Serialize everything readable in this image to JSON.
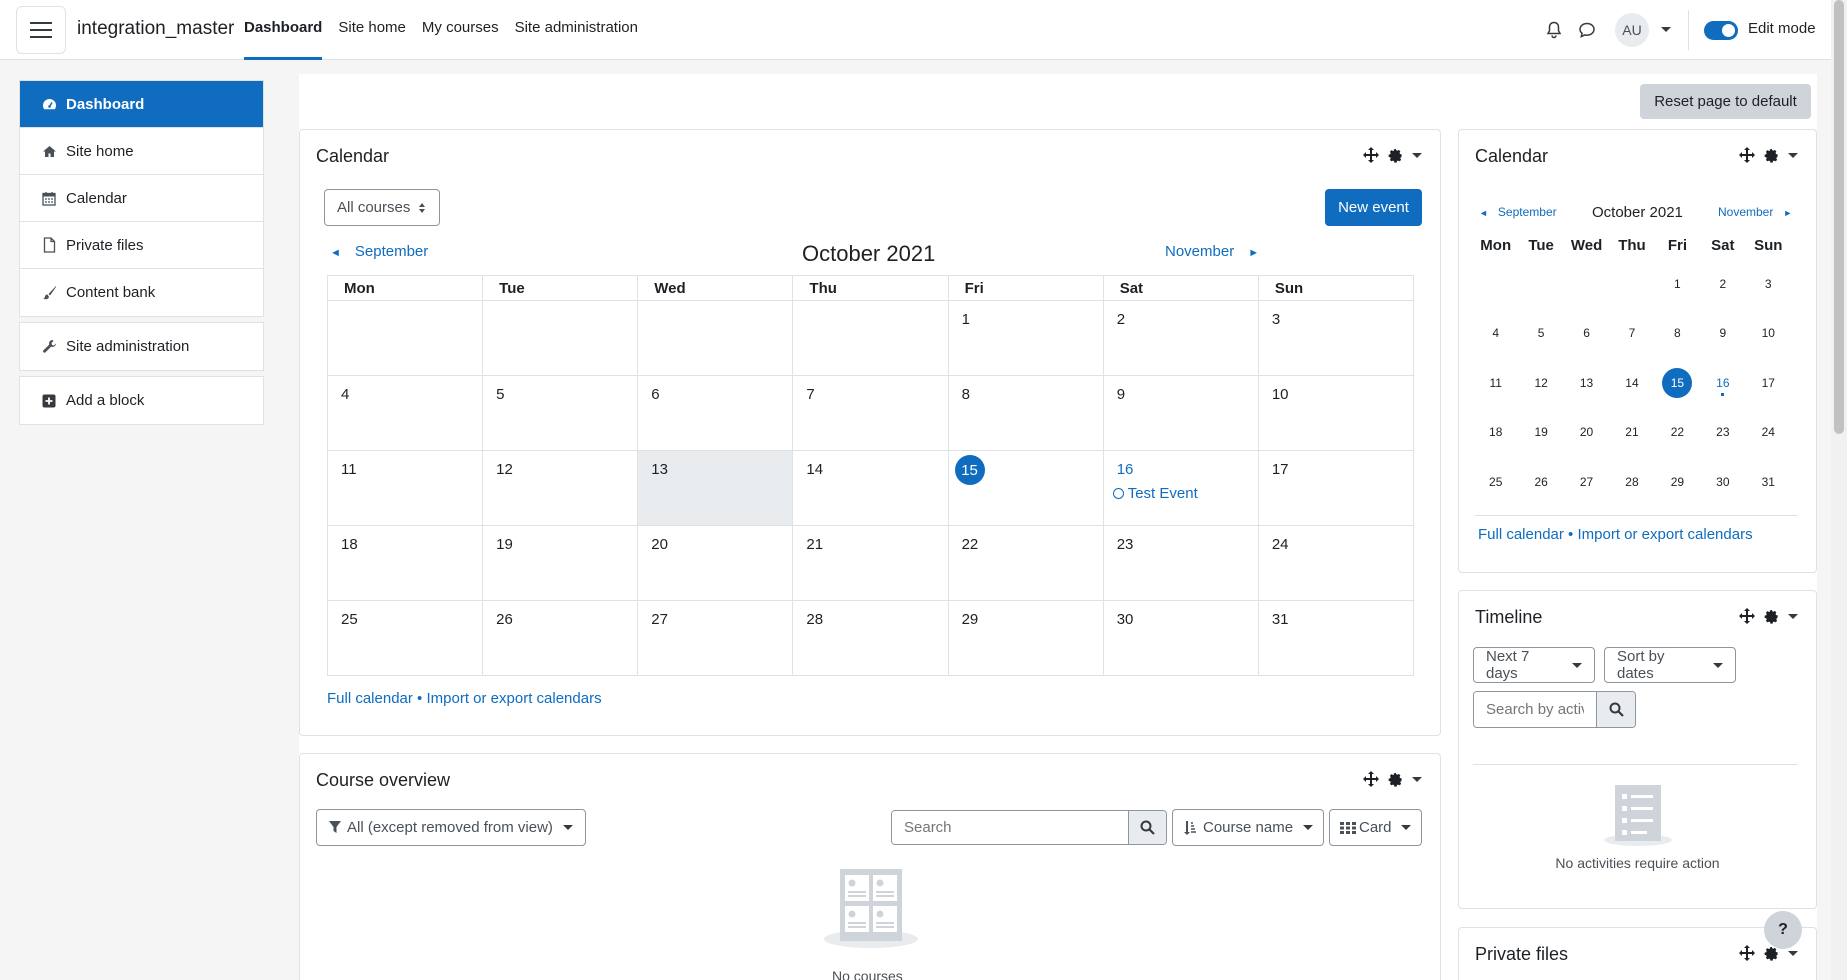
{
  "navbar": {
    "site_name": "integration_master",
    "nav_items": [
      "Dashboard",
      "Site home",
      "My courses",
      "Site administration"
    ],
    "avatar_initials": "AU",
    "edit_mode_label": "Edit mode",
    "edit_mode_on": true
  },
  "drawer": {
    "group1": [
      {
        "label": "Dashboard",
        "icon": "dashboard-icon",
        "active": true
      },
      {
        "label": "Site home",
        "icon": "home-icon"
      },
      {
        "label": "Calendar",
        "icon": "calendar-icon"
      },
      {
        "label": "Private files",
        "icon": "file-icon"
      },
      {
        "label": "Content bank",
        "icon": "paintbrush-icon"
      }
    ],
    "group2": [
      {
        "label": "Site administration",
        "icon": "wrench-icon"
      }
    ],
    "group3": [
      {
        "label": "Add a block",
        "icon": "plus-square-icon"
      }
    ]
  },
  "reset_button": "Reset page to default",
  "calendar_block": {
    "title": "Calendar",
    "course_filter": "All courses",
    "new_event": "New event",
    "prev_month": "September",
    "next_month": "November",
    "month_title": "October 2021",
    "weekdays": [
      "Mon",
      "Tue",
      "Wed",
      "Thu",
      "Fri",
      "Sat",
      "Sun"
    ],
    "weeks": [
      [
        "",
        "",
        "",
        "",
        "1",
        "2",
        "3"
      ],
      [
        "4",
        "5",
        "6",
        "7",
        "8",
        "9",
        "10"
      ],
      [
        "11",
        "12",
        "13",
        "14",
        "15",
        "16",
        "17"
      ],
      [
        "18",
        "19",
        "20",
        "21",
        "22",
        "23",
        "24"
      ],
      [
        "25",
        "26",
        "27",
        "28",
        "29",
        "30",
        "31"
      ]
    ],
    "today": "15",
    "highlighted_day": "13",
    "event_day": "16",
    "event_name": "Test Event",
    "full_calendar": "Full calendar",
    "separator": " • ",
    "import_export": "Import or export calendars"
  },
  "course_overview": {
    "title": "Course overview",
    "filter": "All (except removed from view)",
    "search_placeholder": "Search",
    "sort": "Course name",
    "view": "Card",
    "empty_text": "No courses"
  },
  "mini_calendar": {
    "title": "Calendar",
    "prev_month": "September",
    "next_month": "November",
    "month_title": "October 2021",
    "weekdays": [
      "Mon",
      "Tue",
      "Wed",
      "Thu",
      "Fri",
      "Sat",
      "Sun"
    ],
    "weeks": [
      [
        "",
        "",
        "",
        "",
        "1",
        "2",
        "3"
      ],
      [
        "4",
        "5",
        "6",
        "7",
        "8",
        "9",
        "10"
      ],
      [
        "11",
        "12",
        "13",
        "14",
        "15",
        "16",
        "17"
      ],
      [
        "18",
        "19",
        "20",
        "21",
        "22",
        "23",
        "24"
      ],
      [
        "25",
        "26",
        "27",
        "28",
        "29",
        "30",
        "31"
      ]
    ],
    "today": "15",
    "event_day": "16",
    "full_calendar": "Full calendar",
    "separator": " • ",
    "import_export": "Import or export calendars"
  },
  "timeline": {
    "title": "Timeline",
    "range": "Next 7 days",
    "sort": "Sort by dates",
    "search_placeholder": "Search by activity type or name",
    "empty_text": "No activities require action"
  },
  "private_files": {
    "title": "Private files"
  },
  "help": "?",
  "colors": {
    "primary": "#0f6cbf",
    "border": "#dee2e6",
    "background": "#f5f5f5"
  }
}
